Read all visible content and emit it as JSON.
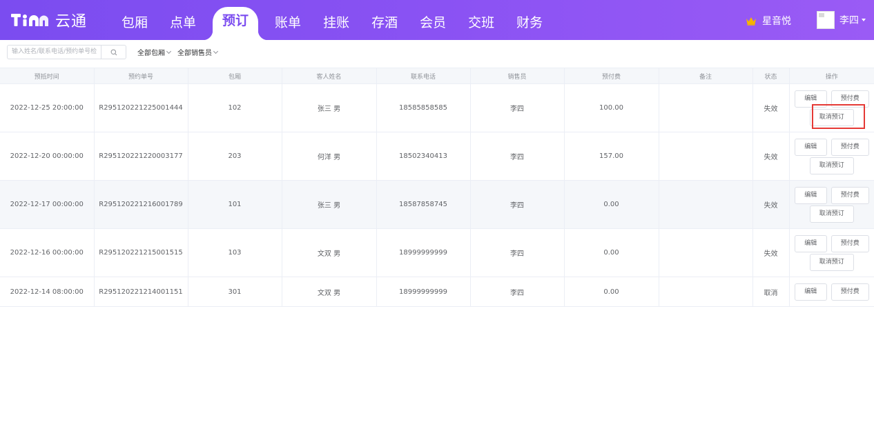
{
  "header": {
    "brand": "云通",
    "logo_text": "TiAn",
    "nav": [
      {
        "label": "包厢",
        "active": false
      },
      {
        "label": "点单",
        "active": false
      },
      {
        "label": "预订",
        "active": true
      },
      {
        "label": "账单",
        "active": false
      },
      {
        "label": "挂账",
        "active": false
      },
      {
        "label": "存酒",
        "active": false
      },
      {
        "label": "会员",
        "active": false
      },
      {
        "label": "交班",
        "active": false
      },
      {
        "label": "财务",
        "active": false
      }
    ],
    "store_name": "星音悦",
    "user_name": "李四",
    "colors": {
      "accent": "#7b4cf0",
      "crown": "#f6b400"
    }
  },
  "filter": {
    "search_placeholder": "输入姓名/联系电话/预约单号检",
    "room_dropdown": "全部包厢",
    "sales_dropdown": "全部销售员"
  },
  "table": {
    "columns": [
      "预抵时间",
      "预约单号",
      "包厢",
      "客人姓名",
      "联系电话",
      "销售员",
      "预付费",
      "备注",
      "状态",
      "操作"
    ],
    "actions": {
      "edit": "编辑",
      "prepay": "预付费",
      "cancel": "取消预订"
    },
    "rows": [
      {
        "time": "2022-12-25 20:00:00",
        "order": "R295120221225001444",
        "room": "102",
        "guest": "张三  男",
        "phone": "18585858585",
        "sales": "李四",
        "prepaid": "100.00",
        "note": "",
        "status": "失效"
      },
      {
        "time": "2022-12-20 00:00:00",
        "order": "R295120221220003177",
        "room": "203",
        "guest": "何洋  男",
        "phone": "18502340413",
        "sales": "李四",
        "prepaid": "157.00",
        "note": "",
        "status": "失效"
      },
      {
        "time": "2022-12-17 00:00:00",
        "order": "R295120221216001789",
        "room": "101",
        "guest": "张三  男",
        "phone": "18587858745",
        "sales": "李四",
        "prepaid": "0.00",
        "note": "",
        "status": "失效"
      },
      {
        "time": "2022-12-16 00:00:00",
        "order": "R295120221215001515",
        "room": "103",
        "guest": "文双  男",
        "phone": "18999999999",
        "sales": "李四",
        "prepaid": "0.00",
        "note": "",
        "status": "失效"
      },
      {
        "time": "2022-12-14 08:00:00",
        "order": "R295120221214001151",
        "room": "301",
        "guest": "文双  男",
        "phone": "18999999999",
        "sales": "李四",
        "prepaid": "0.00",
        "note": "",
        "status": "取消"
      }
    ]
  }
}
